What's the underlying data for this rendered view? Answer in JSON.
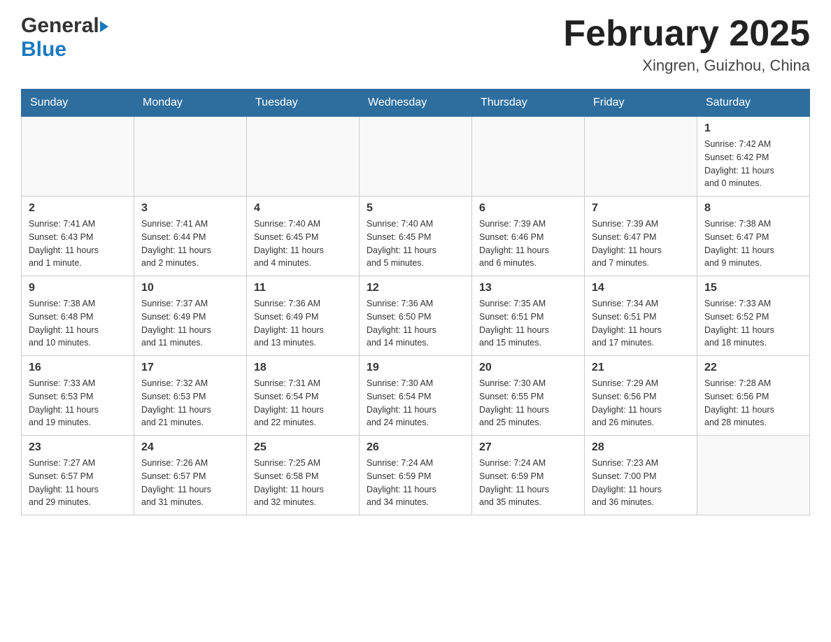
{
  "header": {
    "logo_general": "General",
    "logo_blue": "Blue",
    "month_title": "February 2025",
    "location": "Xingren, Guizhou, China"
  },
  "days_of_week": [
    "Sunday",
    "Monday",
    "Tuesday",
    "Wednesday",
    "Thursday",
    "Friday",
    "Saturday"
  ],
  "weeks": [
    {
      "days": [
        {
          "number": "",
          "info": ""
        },
        {
          "number": "",
          "info": ""
        },
        {
          "number": "",
          "info": ""
        },
        {
          "number": "",
          "info": ""
        },
        {
          "number": "",
          "info": ""
        },
        {
          "number": "",
          "info": ""
        },
        {
          "number": "1",
          "info": "Sunrise: 7:42 AM\nSunset: 6:42 PM\nDaylight: 11 hours\nand 0 minutes."
        }
      ]
    },
    {
      "days": [
        {
          "number": "2",
          "info": "Sunrise: 7:41 AM\nSunset: 6:43 PM\nDaylight: 11 hours\nand 1 minute."
        },
        {
          "number": "3",
          "info": "Sunrise: 7:41 AM\nSunset: 6:44 PM\nDaylight: 11 hours\nand 2 minutes."
        },
        {
          "number": "4",
          "info": "Sunrise: 7:40 AM\nSunset: 6:45 PM\nDaylight: 11 hours\nand 4 minutes."
        },
        {
          "number": "5",
          "info": "Sunrise: 7:40 AM\nSunset: 6:45 PM\nDaylight: 11 hours\nand 5 minutes."
        },
        {
          "number": "6",
          "info": "Sunrise: 7:39 AM\nSunset: 6:46 PM\nDaylight: 11 hours\nand 6 minutes."
        },
        {
          "number": "7",
          "info": "Sunrise: 7:39 AM\nSunset: 6:47 PM\nDaylight: 11 hours\nand 7 minutes."
        },
        {
          "number": "8",
          "info": "Sunrise: 7:38 AM\nSunset: 6:47 PM\nDaylight: 11 hours\nand 9 minutes."
        }
      ]
    },
    {
      "days": [
        {
          "number": "9",
          "info": "Sunrise: 7:38 AM\nSunset: 6:48 PM\nDaylight: 11 hours\nand 10 minutes."
        },
        {
          "number": "10",
          "info": "Sunrise: 7:37 AM\nSunset: 6:49 PM\nDaylight: 11 hours\nand 11 minutes."
        },
        {
          "number": "11",
          "info": "Sunrise: 7:36 AM\nSunset: 6:49 PM\nDaylight: 11 hours\nand 13 minutes."
        },
        {
          "number": "12",
          "info": "Sunrise: 7:36 AM\nSunset: 6:50 PM\nDaylight: 11 hours\nand 14 minutes."
        },
        {
          "number": "13",
          "info": "Sunrise: 7:35 AM\nSunset: 6:51 PM\nDaylight: 11 hours\nand 15 minutes."
        },
        {
          "number": "14",
          "info": "Sunrise: 7:34 AM\nSunset: 6:51 PM\nDaylight: 11 hours\nand 17 minutes."
        },
        {
          "number": "15",
          "info": "Sunrise: 7:33 AM\nSunset: 6:52 PM\nDaylight: 11 hours\nand 18 minutes."
        }
      ]
    },
    {
      "days": [
        {
          "number": "16",
          "info": "Sunrise: 7:33 AM\nSunset: 6:53 PM\nDaylight: 11 hours\nand 19 minutes."
        },
        {
          "number": "17",
          "info": "Sunrise: 7:32 AM\nSunset: 6:53 PM\nDaylight: 11 hours\nand 21 minutes."
        },
        {
          "number": "18",
          "info": "Sunrise: 7:31 AM\nSunset: 6:54 PM\nDaylight: 11 hours\nand 22 minutes."
        },
        {
          "number": "19",
          "info": "Sunrise: 7:30 AM\nSunset: 6:54 PM\nDaylight: 11 hours\nand 24 minutes."
        },
        {
          "number": "20",
          "info": "Sunrise: 7:30 AM\nSunset: 6:55 PM\nDaylight: 11 hours\nand 25 minutes."
        },
        {
          "number": "21",
          "info": "Sunrise: 7:29 AM\nSunset: 6:56 PM\nDaylight: 11 hours\nand 26 minutes."
        },
        {
          "number": "22",
          "info": "Sunrise: 7:28 AM\nSunset: 6:56 PM\nDaylight: 11 hours\nand 28 minutes."
        }
      ]
    },
    {
      "days": [
        {
          "number": "23",
          "info": "Sunrise: 7:27 AM\nSunset: 6:57 PM\nDaylight: 11 hours\nand 29 minutes."
        },
        {
          "number": "24",
          "info": "Sunrise: 7:26 AM\nSunset: 6:57 PM\nDaylight: 11 hours\nand 31 minutes."
        },
        {
          "number": "25",
          "info": "Sunrise: 7:25 AM\nSunset: 6:58 PM\nDaylight: 11 hours\nand 32 minutes."
        },
        {
          "number": "26",
          "info": "Sunrise: 7:24 AM\nSunset: 6:59 PM\nDaylight: 11 hours\nand 34 minutes."
        },
        {
          "number": "27",
          "info": "Sunrise: 7:24 AM\nSunset: 6:59 PM\nDaylight: 11 hours\nand 35 minutes."
        },
        {
          "number": "28",
          "info": "Sunrise: 7:23 AM\nSunset: 7:00 PM\nDaylight: 11 hours\nand 36 minutes."
        },
        {
          "number": "",
          "info": ""
        }
      ]
    }
  ]
}
